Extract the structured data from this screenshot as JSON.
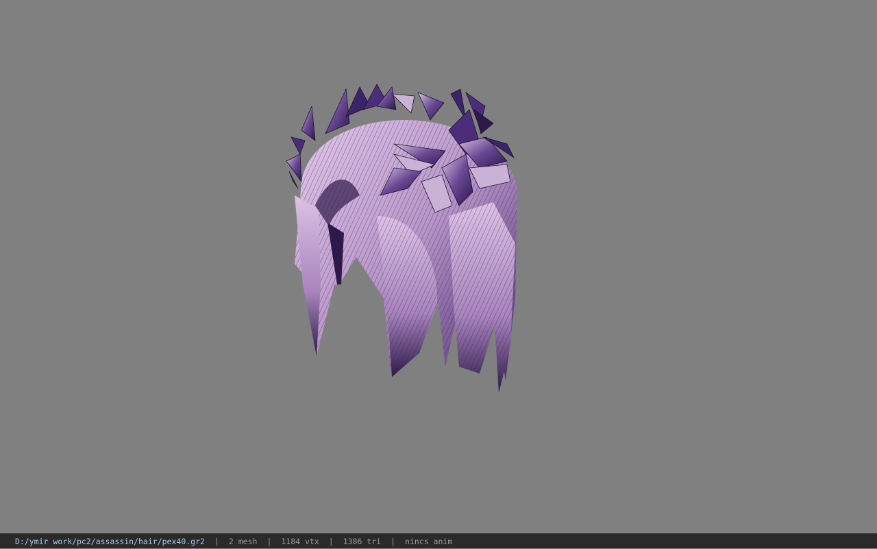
{
  "viewport": {
    "background": "#808080",
    "model_name": "purple-hair-with-leaf-crown"
  },
  "colors": {
    "hair_light": "#d8bde0",
    "hair_dark": "#3a2260",
    "leaf_dark": "#3c2468",
    "leaf_light": "#c9b2d6"
  },
  "statusbar": {
    "file_path": "D:/ymir work/pc2/assassin/hair/pex40.gr2",
    "separator": "|",
    "mesh_count": "2 mesh",
    "vertex_count": "1184 vtx",
    "triangle_count": "1386 tri",
    "anim_status": "nincs anim"
  }
}
